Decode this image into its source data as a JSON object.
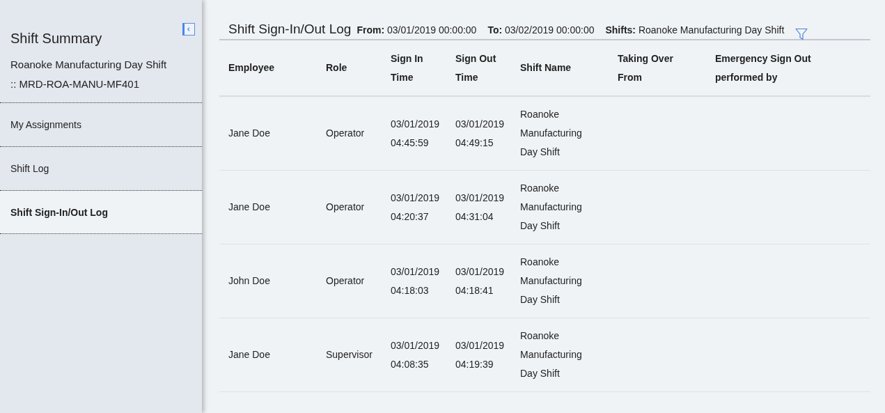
{
  "sidebar": {
    "title": "Shift Summary",
    "subtitle": "Roanoke Manufacturing Day Shift :: MRD-ROA-MANU-MF401",
    "items": [
      {
        "label": "My Assignments",
        "selected": false
      },
      {
        "label": "Shift Log",
        "selected": false
      },
      {
        "label": "Shift Sign-In/Out Log",
        "selected": true
      }
    ]
  },
  "main": {
    "title": "Shift Sign-In/Out Log",
    "filters": [
      "**From:** 03/01/2019 00:00:00",
      "**To:** 03/02/2019 00:00:00",
      "**Shifts:** Roanoke Manufacturing Day Shift"
    ]
  },
  "table": {
    "columns": [
      "Employee",
      "Role",
      "Sign In Time",
      "Sign Out Time",
      "Shift Name",
      "Taking Over From",
      "Emergency Sign Out performed by"
    ],
    "rows": [
      [
        "Jane Doe",
        "Operator",
        "03/01/2019 04:45:59",
        "03/01/2019 04:49:15",
        "Roanoke Manufacturing Day Shift"
      ],
      [
        "Jane Doe",
        "Operator",
        "03/01/2019 04:20:37",
        "03/01/2019 04:31:04",
        "Roanoke Manufacturing Day Shift"
      ],
      [
        "John Doe",
        "Operator",
        "03/01/2019 04:18:03",
        "03/01/2019 04:18:41",
        "Roanoke Manufacturing Day Shift"
      ],
      [
        "Jane Doe",
        "Supervisor",
        "03/01/2019 04:08:35",
        "03/01/2019 04:19:39",
        "Roanoke Manufacturing Day Shift"
      ]
    ]
  }
}
